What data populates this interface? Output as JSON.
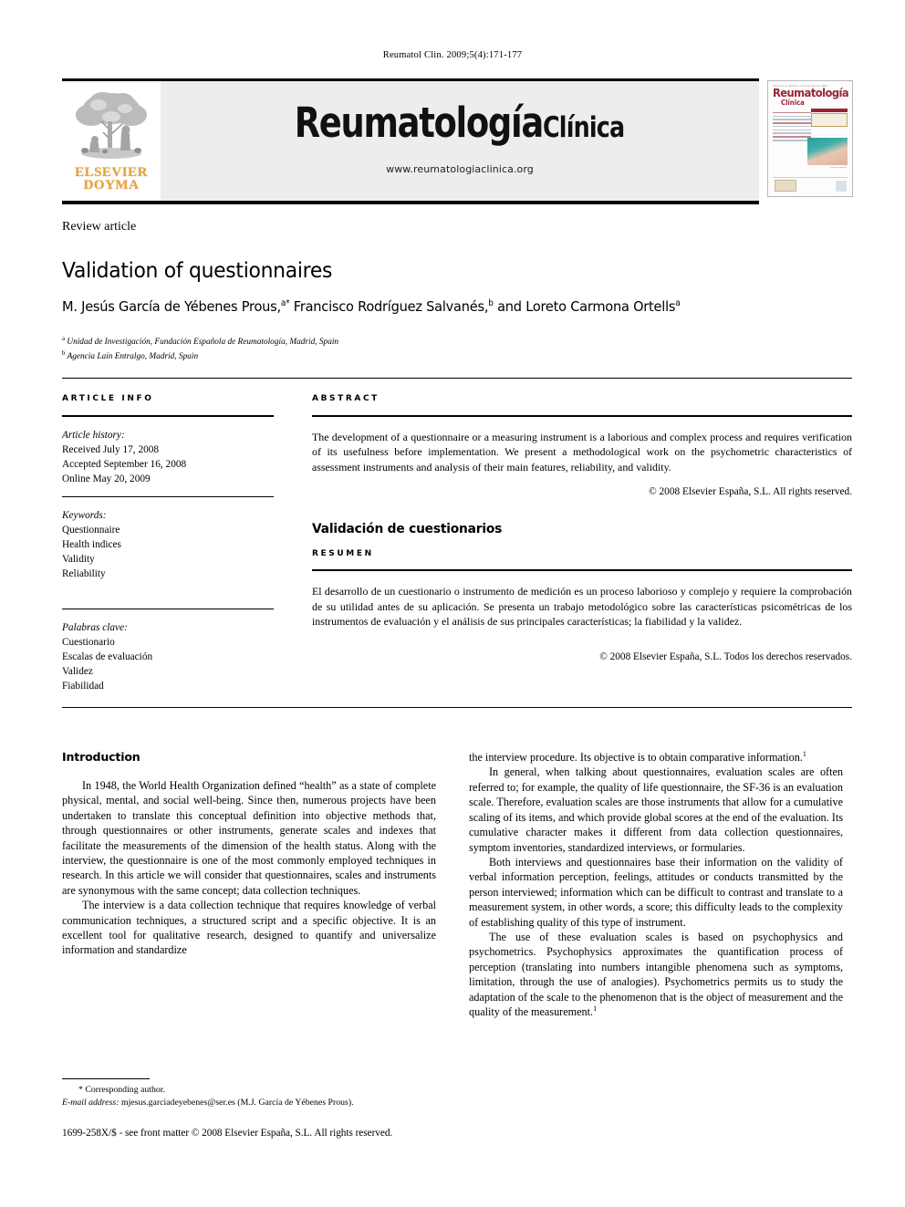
{
  "running_head": "Reumatol Clin. 2009;5(4):171-177",
  "masthead": {
    "publisher_line1": "ELSEVIER",
    "publisher_line2": "DOYMA",
    "journal_title_main": "Reumatología",
    "journal_title_sub": "Clínica",
    "journal_url": "www.reumatologiaclinica.org"
  },
  "cover": {
    "kicker": "Volumen 5, Número 4, Julio-Agosto 2009",
    "title": "Reumatología",
    "subtitle": "Clínica",
    "photo_caption": "Artritis reumatoide"
  },
  "article": {
    "kicker": "Review article",
    "title": "Validation of questionnaires",
    "authors_plain": "M. Jesús García de Yébenes Prous, a* Francisco Rodríguez Salvanés, b and Loreto Carmona Ortells a",
    "author1": "M. Jesús García de Yébenes Prous,",
    "author1_marks": "a*",
    "author2": "Francisco Rodríguez Salvanés,",
    "author2_marks": "b",
    "author_conj": "and",
    "author3": "Loreto Carmona Ortells",
    "author3_marks": "a",
    "affiliation_a_mark": "a",
    "affiliation_a": "Unidad de Investigación, Fundación Española de Reumatología, Madrid, Spain",
    "affiliation_b_mark": "b",
    "affiliation_b": "Agencia Laín Entralgo, Madrid, Spain"
  },
  "info": {
    "heading": "ARTICLE INFO",
    "history_label": "Article history:",
    "history": [
      "Received July 17, 2008",
      "Accepted September 16, 2008",
      "Online May 20, 2009"
    ],
    "keywords_label": "Keywords:",
    "keywords": [
      "Questionnaire",
      "Health indices",
      "Validity",
      "Reliability"
    ],
    "palabras_label": "Palabras clave:",
    "palabras": [
      "Cuestionario",
      "Escalas de evaluación",
      "Validez",
      "Fiabilidad"
    ]
  },
  "abstract": {
    "heading": "ABSTRACT",
    "text": "The development of a questionnaire or a measuring instrument is a laborious and complex process and requires verification of its usefulness before implementation. We present a methodological work on the psychometric characteristics of assessment instruments and analysis of their main features, reliability, and validity.",
    "copyright": "© 2008 Elsevier España, S.L. All rights reserved."
  },
  "resumen": {
    "title": "Validación de cuestionarios",
    "heading": "RESUMEN",
    "text": "El desarrollo de un cuestionario o instrumento de medición es un proceso laborioso y complejo y requiere la comprobación de su utilidad antes de su aplicación. Se presenta un trabajo metodológico sobre las características psicométricas de los instrumentos de evaluación y el análisis de sus principales características; la fiabilidad y la validez.",
    "copyright": "© 2008 Elsevier España, S.L. Todos los derechos reservados."
  },
  "body": {
    "heading": "Introduction",
    "left_paragraphs": [
      "In 1948, the World Health Organization defined “health” as a state of complete physical, mental, and social well-being. Since then, numerous projects have been undertaken to translate this conceptual definition into objective methods that, through questionnaires or other instruments, generate scales and indexes that facilitate the measurements of the dimension of the health status. Along with the interview, the questionnaire is one of the most commonly employed techniques in research. In this article we will consider that questionnaires, scales and instruments are synonymous with the same concept; data collection techniques.",
      "The interview is a data collection technique that requires knowledge of verbal communication techniques, a structured script and a specific objective. It is an excellent tool for qualitative research, designed to quantify and universalize information and standardize"
    ],
    "right_paragraphs": [
      "the interview procedure. Its objective is to obtain comparative information.1",
      "In general, when talking about questionnaires, evaluation scales are often referred to; for example, the quality of life questionnaire, the SF-36 is an evaluation scale. Therefore, evaluation scales are those instruments that allow for a cumulative scaling of its items, and which provide global scores at the end of the evaluation. Its cumulative character makes it different from data collection questionnaires, symptom inventories, standardized interviews, or formularies.",
      "Both interviews and questionnaires base their information on the validity of verbal information perception, feelings, attitudes or conducts transmitted by the person interviewed; information which can be difficult to contrast and translate to a measurement system, in other words, a score; this difficulty leads to the complexity of establishing quality of this type of instrument.",
      "The use of these evaluation scales is based on psychophysics and psychometrics. Psychophysics approximates the quantification process of perception (translating into numbers intangible phenomena such as symptoms, limitation, through the use of analogies). Psychometrics permits us to study the adaptation of the scale to the phenomenon that is the object of measurement and the quality of the measurement.1"
    ],
    "right_p1_text": "the interview procedure. Its objective is to obtain comparative information.",
    "right_p1_ref": "1",
    "right_p4_text": "The use of these evaluation scales is based on psychophysics and psychometrics. Psychophysics approximates the quantification process of perception (translating into numbers intangible phenomena such as symptoms, limitation, through the use of analogies). Psychometrics permits us to study the adaptation of the scale to the phenomenon that is the object of measurement and the quality of the measurement.",
    "right_p4_ref": "1"
  },
  "footnote": {
    "star": "*",
    "corresponding": "Corresponding author.",
    "email_label": "E-mail address:",
    "email_value": "mjesus.garciadeyebenes@ser.es (M.J. García de Yébenes Prous)."
  },
  "footer": {
    "issn_line": "1699-258X/$ - see front matter © 2008 Elsevier España, S.L. All rights reserved."
  },
  "colors": {
    "brand_orange": "#E8A33D",
    "cover_red": "#9b2335",
    "band_gray": "#eceded"
  }
}
